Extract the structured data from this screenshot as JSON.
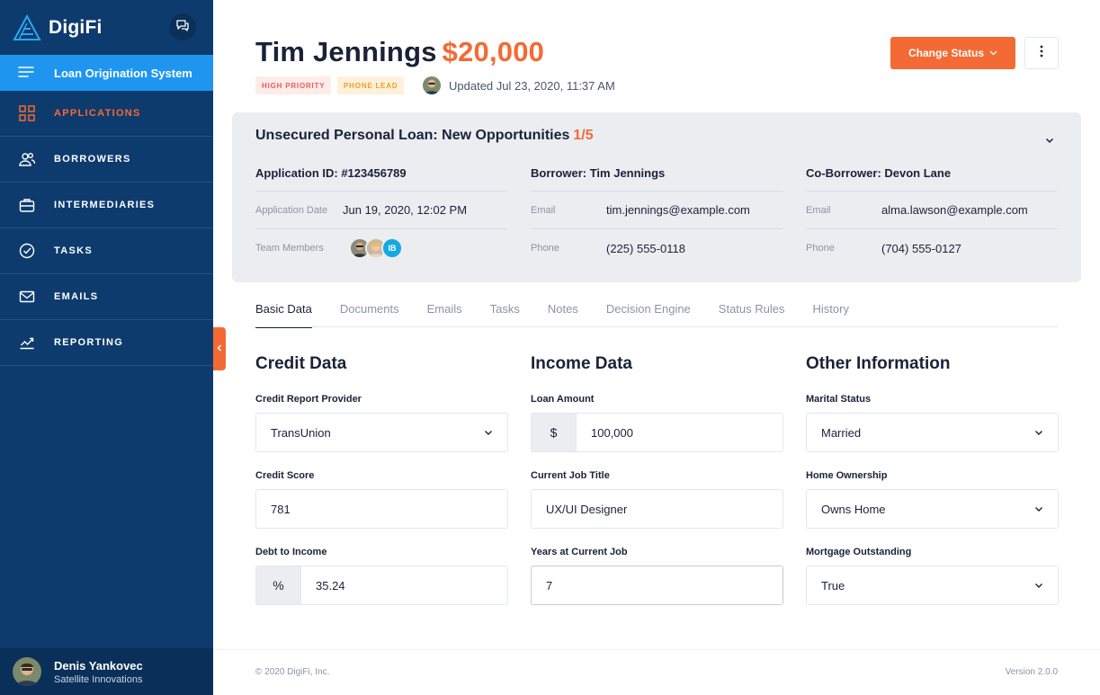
{
  "app": {
    "logo_text": "DigiFi",
    "section_label": "Loan Origination System"
  },
  "nav": {
    "items": [
      {
        "label": "APPLICATIONS",
        "icon": "grid-icon"
      },
      {
        "label": "BORROWERS",
        "icon": "users-icon"
      },
      {
        "label": "INTERMEDIARIES",
        "icon": "briefcase-icon"
      },
      {
        "label": "TASKS",
        "icon": "check-circle-icon"
      },
      {
        "label": "EMAILS",
        "icon": "mail-icon"
      },
      {
        "label": "REPORTING",
        "icon": "chart-icon"
      }
    ],
    "active": "APPLICATIONS"
  },
  "user": {
    "name": "Denis Yankovec",
    "company": "Satellite Innovations"
  },
  "header": {
    "name": "Tim Jennings",
    "amount": "$20,000",
    "badges": [
      "HIGH PRIORITY",
      "PHONE LEAD"
    ],
    "updated": "Updated Jul 23, 2020, 11:37 AM",
    "change_status_label": "Change Status"
  },
  "summary": {
    "title": "Unsecured Personal Loan: New Opportunities",
    "count": "1/5",
    "application": {
      "heading": "Application ID: #123456789",
      "date_label": "Application Date",
      "date_value": "Jun 19, 2020, 12:02 PM",
      "team_label": "Team Members",
      "team_initials": "IB"
    },
    "borrower": {
      "heading": "Borrower: Tim Jennings",
      "email_label": "Email",
      "email": "tim.jennings@example.com",
      "phone_label": "Phone",
      "phone": "(225) 555-0118"
    },
    "coborrower": {
      "heading": "Co-Borrower: Devon Lane",
      "email_label": "Email",
      "email": "alma.lawson@example.com",
      "phone_label": "Phone",
      "phone": "(704) 555-0127"
    }
  },
  "tabs": [
    "Basic Data",
    "Documents",
    "Emails",
    "Tasks",
    "Notes",
    "Decision Engine",
    "Status Rules",
    "History"
  ],
  "active_tab": "Basic Data",
  "credit": {
    "title": "Credit Data",
    "provider_label": "Credit Report Provider",
    "provider_value": "TransUnion",
    "score_label": "Credit Score",
    "score_value": "781",
    "dti_label": "Debt to Income",
    "dti_prefix": "%",
    "dti_value": "35.24"
  },
  "income": {
    "title": "Income Data",
    "amount_label": "Loan Amount",
    "amount_prefix": "$",
    "amount_value": "100,000",
    "job_label": "Current Job Title",
    "job_value": "UX/UI Designer",
    "years_label": "Years at Current Job",
    "years_value": "7"
  },
  "other": {
    "title": "Other Information",
    "marital_label": "Marital Status",
    "marital_value": "Married",
    "home_label": "Home Ownership",
    "home_value": "Owns Home",
    "mortgage_label": "Mortgage Outstanding",
    "mortgage_value": "True"
  },
  "footer": {
    "copyright": "© 2020 DigiFi, Inc.",
    "version": "Version 2.0.0"
  },
  "colors": {
    "sidebar": "#0e3b6e",
    "accent": "#f46a34",
    "active_nav_bg": "#1e96f0",
    "card_bg": "#ebedf1"
  }
}
